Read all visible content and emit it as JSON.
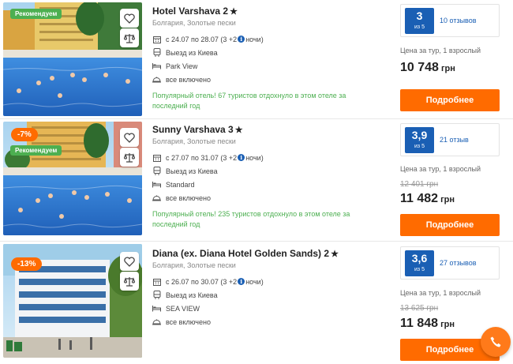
{
  "hotels": [
    {
      "name": "Hotel Varshava 2",
      "location": "Болгария, Золотые пески",
      "badge_recommended": "Рекомендуем",
      "badge_discount": "",
      "dates_prefix": "с 24.07 по 28.07 (3 +2",
      "dates_suffix": "ночи)",
      "departure": "Выезд из Киева",
      "room": "Park View",
      "meal": "все включено",
      "popular": "Популярный отель! 67 туристов отдохнуло в этом отеле за последний год",
      "score": "3",
      "score_of": "из 5",
      "reviews": "10 отзывов",
      "price_label": "Цена за тур, 1 взрослый",
      "old_price": "",
      "price": "10 748",
      "currency": "грн",
      "button": "Подробнее"
    },
    {
      "name": "Sunny Varshava 3",
      "location": "Болгария, Золотые пески",
      "badge_recommended": "Рекомендуем",
      "badge_discount": "-7%",
      "dates_prefix": "с 27.07 по 31.07 (3 +2",
      "dates_suffix": "ночи)",
      "departure": "Выезд из Киева",
      "room": "Standard",
      "meal": "все включено",
      "popular": "Популярный отель! 235 туристов отдохнуло в этом отеле за последний год",
      "score": "3,9",
      "score_of": "из 5",
      "reviews": "21 отзыв",
      "price_label": "Цена за тур, 1 взрослый",
      "old_price": "12 401 грн",
      "price": "11 482",
      "currency": "грн",
      "button": "Подробнее"
    },
    {
      "name": "Diana (ex. Diana Hotel Golden Sands) 2",
      "location": "Болгария, Золотые пески",
      "badge_recommended": "",
      "badge_discount": "-13%",
      "dates_prefix": "с 26.07 по 30.07 (3 +2",
      "dates_suffix": "ночи)",
      "departure": "Выезд из Киева",
      "room": "SEA VIEW",
      "meal": "все включено",
      "popular": "",
      "score": "3,6",
      "score_of": "из 5",
      "reviews": "27 отзывов",
      "price_label": "Цена за тур, 1 взрослый",
      "old_price": "13 625 грн",
      "price": "11 848",
      "currency": "грн",
      "button": "Подробнее"
    }
  ],
  "star_glyph": "★",
  "info_glyph": "i",
  "colors": {
    "accent": "#ff6b00",
    "score_blue": "#1a5fb4",
    "green": "#4caf50"
  },
  "icons": [
    "heart-icon",
    "compare-scales-icon",
    "calendar-icon",
    "bus-icon",
    "bed-icon",
    "meal-cloche-icon",
    "info-icon",
    "phone-icon"
  ]
}
